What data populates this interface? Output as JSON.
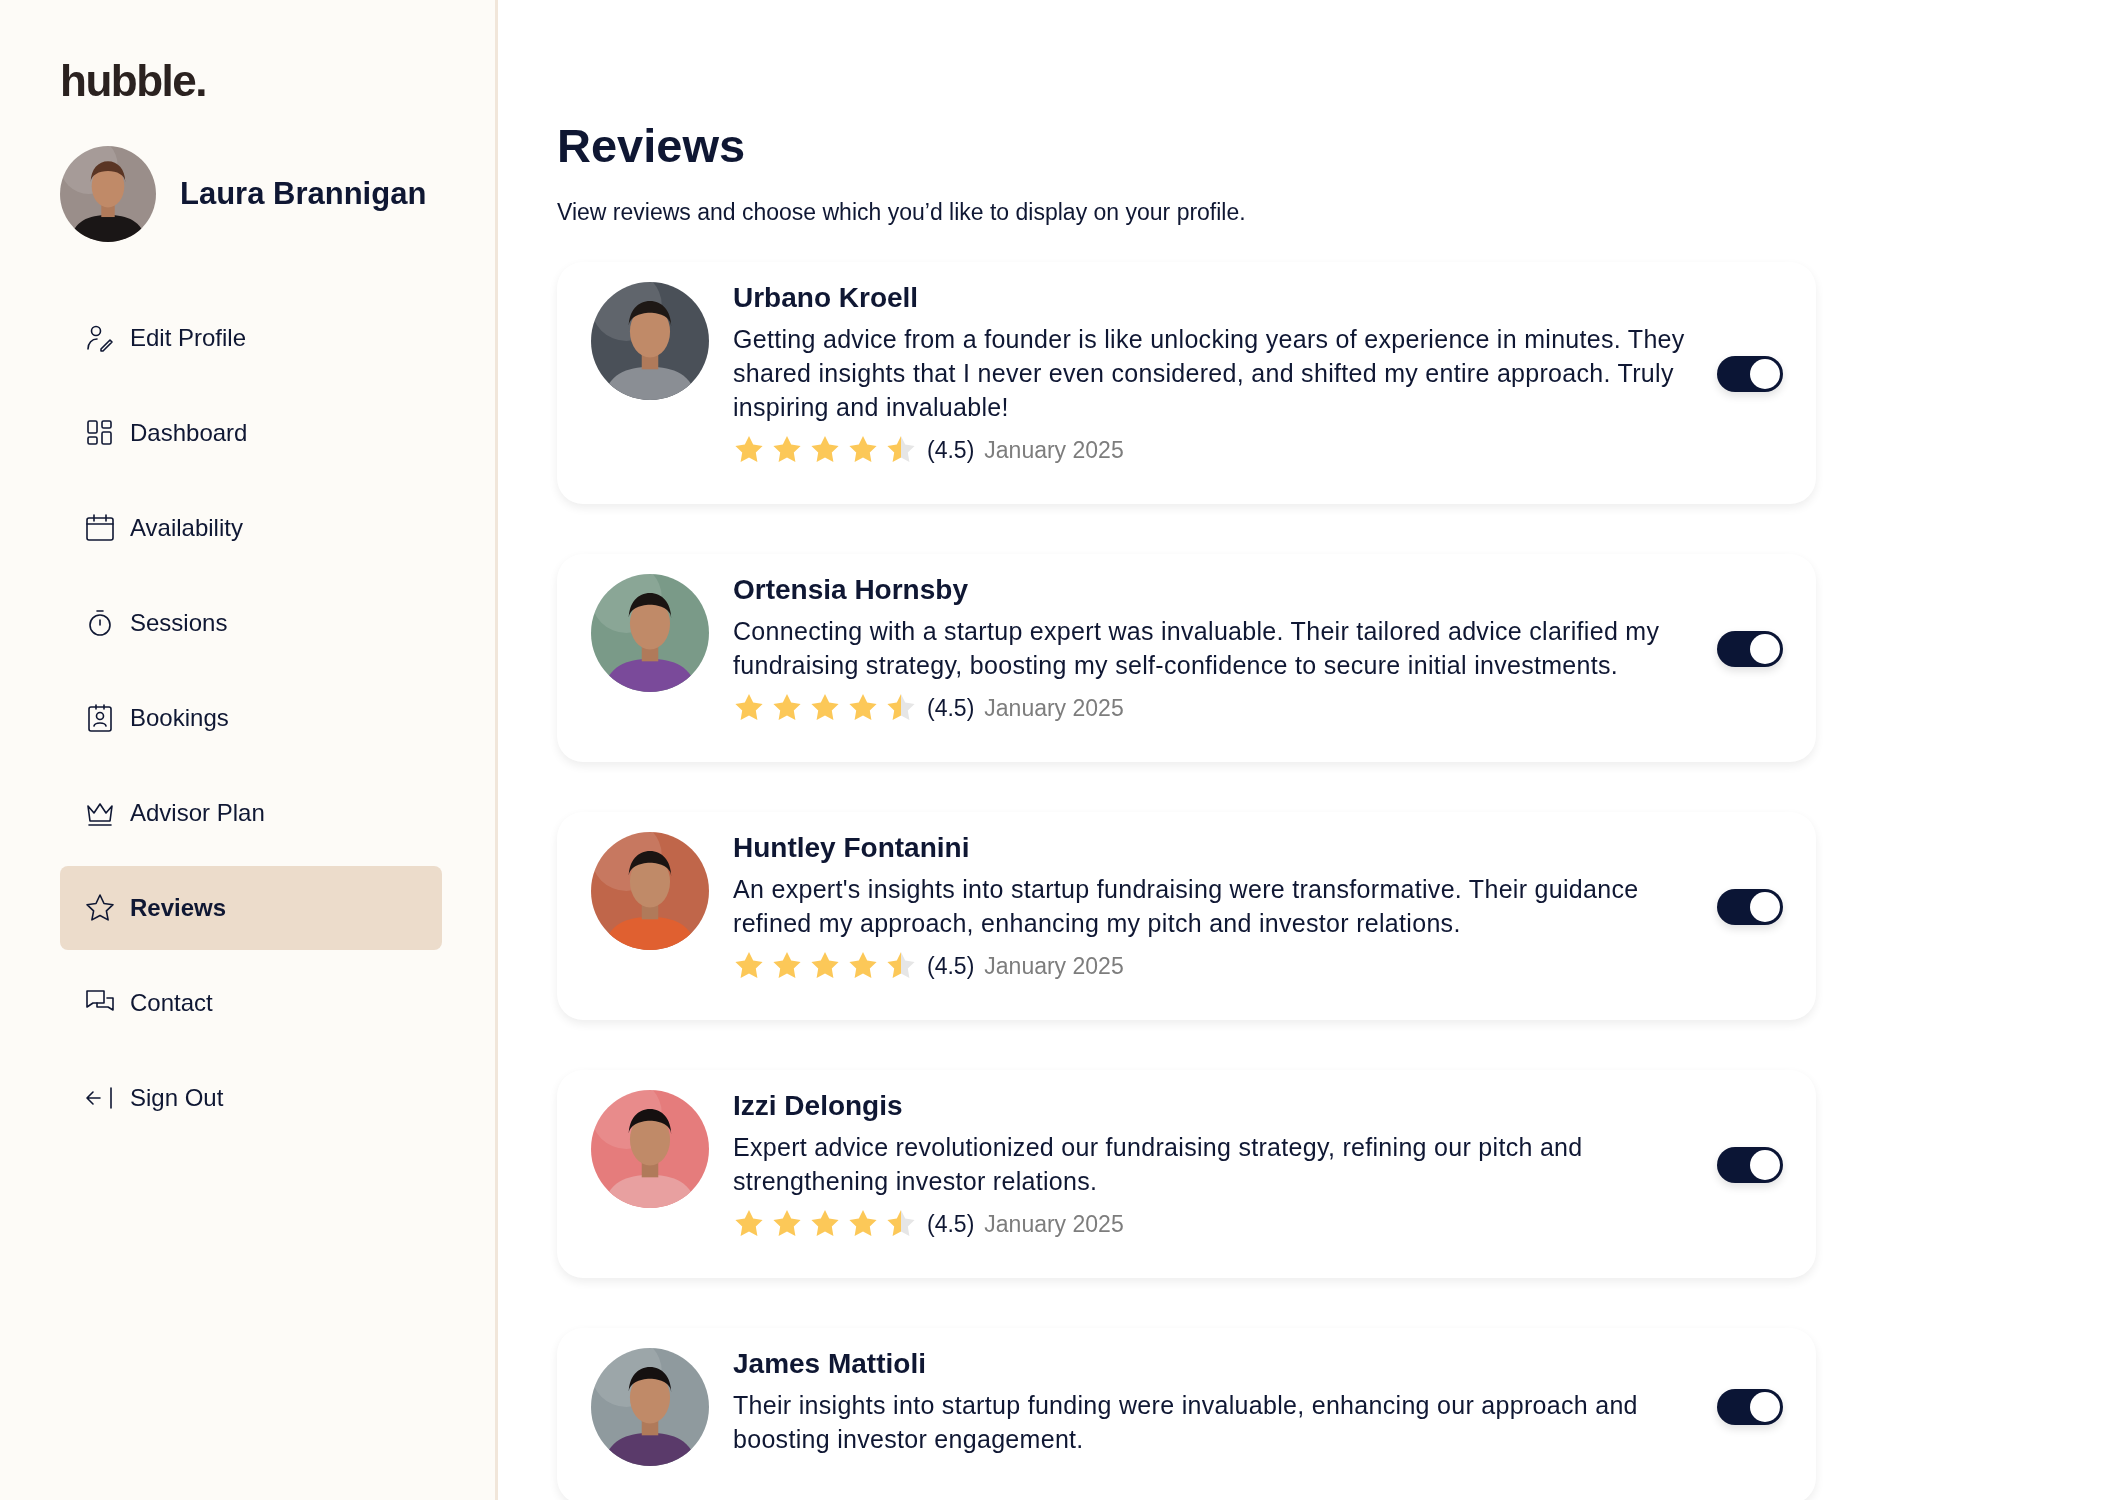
{
  "sidebar": {
    "logo": "hubble.",
    "user": {
      "name": "Laura Brannigan"
    },
    "items": [
      {
        "label": "Edit Profile",
        "selected": false
      },
      {
        "label": "Dashboard",
        "selected": false
      },
      {
        "label": "Availability",
        "selected": false
      },
      {
        "label": "Sessions",
        "selected": false
      },
      {
        "label": "Bookings",
        "selected": false
      },
      {
        "label": "Advisor Plan",
        "selected": false
      },
      {
        "label": "Reviews",
        "selected": true
      },
      {
        "label": "Contact",
        "selected": false
      },
      {
        "label": "Sign Out",
        "selected": false
      }
    ]
  },
  "page": {
    "title": "Reviews",
    "subtitle": "View reviews and choose which you’d like to display on your profile."
  },
  "reviews": [
    {
      "name": "Urbano Kroell",
      "text": "Getting advice from a founder is like unlocking years of experience in minutes. They shared insights that I never even considered, and shifted my entire approach. Truly inspiring and invaluable!",
      "stars": 4.5,
      "rating": "(4.5)",
      "date": "January 2025",
      "shown": true
    },
    {
      "name": "Ortensia Hornsby",
      "text": "Connecting with a startup expert was invaluable. Their tailored advice clarified my fundraising strategy, boosting my self-confidence to secure initial investments.",
      "stars": 4.5,
      "rating": "(4.5)",
      "date": "January 2025",
      "shown": true
    },
    {
      "name": "Huntley Fontanini",
      "text": "An expert's insights into startup fundraising were transformative. Their guidance refined my approach, enhancing my pitch and investor relations.",
      "stars": 4.5,
      "rating": "(4.5)",
      "date": "January 2025",
      "shown": true
    },
    {
      "name": "Izzi Delongis",
      "text": "Expert advice revolutionized our fundraising strategy, refining our pitch and strengthening investor relations.",
      "stars": 4.5,
      "rating": "(4.5)",
      "date": "January 2025",
      "shown": true
    },
    {
      "name": "James Mattioli",
      "text": "Their insights into startup funding were invaluable, enhancing our approach and boosting investor engagement.",
      "shown": true
    }
  ]
}
